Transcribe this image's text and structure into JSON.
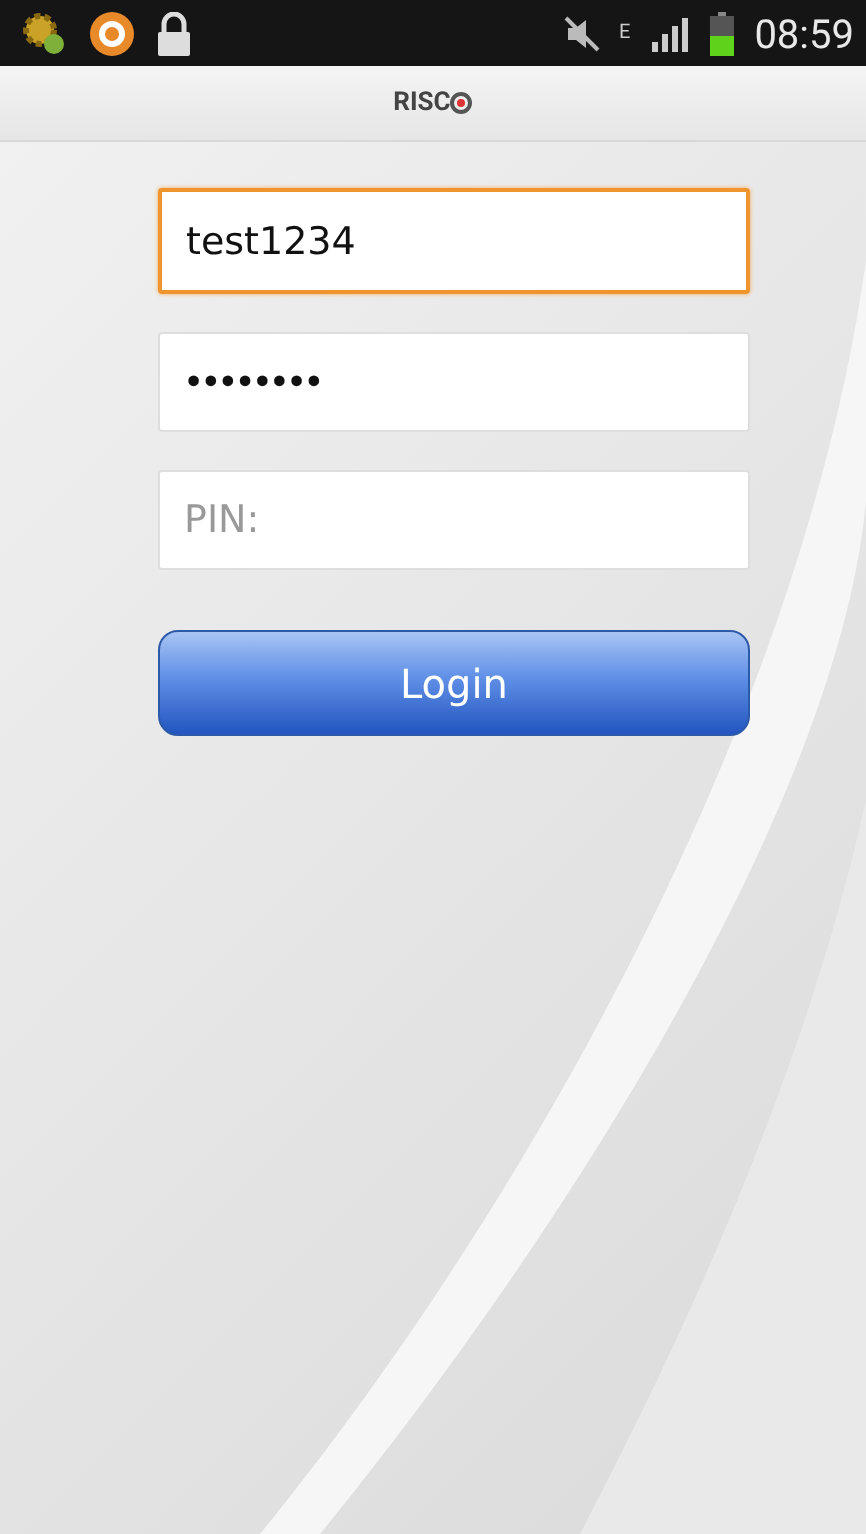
{
  "status_bar": {
    "network_type": "E",
    "time": "08:59"
  },
  "header": {
    "logo": "RISC"
  },
  "fields": [
    {
      "kind": "text",
      "value": "test1234",
      "focused": true
    },
    {
      "kind": "password",
      "value": "••••••••",
      "focused": false
    },
    {
      "kind": "pin",
      "placeholder": "PIN:",
      "focused": false
    }
  ],
  "login_button": {
    "label": "Login"
  }
}
